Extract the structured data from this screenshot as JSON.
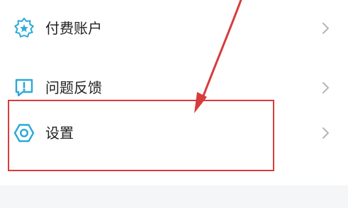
{
  "menu": {
    "items": [
      {
        "label": "付费账户",
        "icon": "star-badge-icon"
      },
      {
        "label": "问题反馈",
        "icon": "feedback-icon"
      },
      {
        "label": "设置",
        "icon": "settings-hexagon-icon"
      }
    ]
  },
  "annotation": {
    "color": "#d83b3b"
  },
  "theme": {
    "accent": "#2aa9d6",
    "text": "#222222",
    "chevron": "#b5b5b5",
    "separator": "#f5f6f7"
  }
}
